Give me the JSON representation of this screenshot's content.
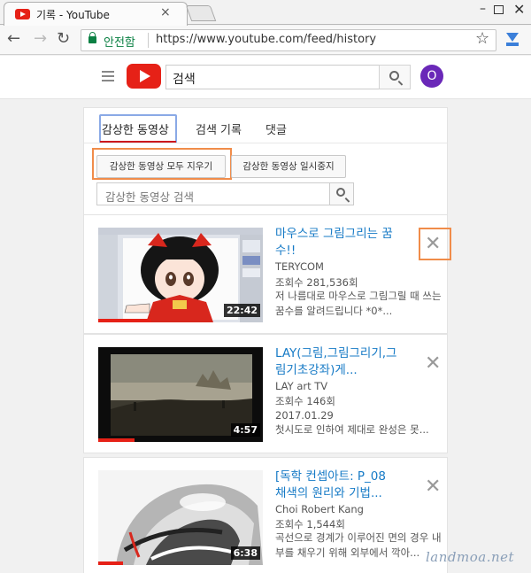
{
  "browser": {
    "tab_title": "기록 - YouTube",
    "tab_close": "×",
    "secure_label": "안전함",
    "url": "https://www.youtube.com/feed/history"
  },
  "youtube": {
    "search_value": "검색",
    "avatar_letter": "O"
  },
  "history_panel": {
    "tabs": [
      {
        "label": "감상한 동영상"
      },
      {
        "label": "검색 기록"
      },
      {
        "label": "댓글"
      }
    ],
    "clear_all_label": "감상한 동영상 모두 지우기",
    "pause_label": "감상한 동영상 일시중지",
    "search_placeholder": "감상한 동영상 검색"
  },
  "videos": [
    {
      "title": "마우스로 그림그리는 꿈수!!",
      "channel": "TERYCOM",
      "views": "조회수 281,536회",
      "date": "",
      "description": "저 나름대로 마우스로 그림그릴 때 쓰는 꿈수를 알려드립니다 *0*...",
      "duration": "22:42",
      "watched_fraction": 0.32
    },
    {
      "title": "LAY(그림,그림그리기,그림기초강좌)게...",
      "channel": "LAY art TV",
      "views": "조회수 146회",
      "date": "2017.01.29",
      "description": "첫시도로 인하여 제대로 완성은 못...",
      "duration": "4:57",
      "watched_fraction": 0.22
    },
    {
      "title": "[독학 컨셉아트: P_08 채색의 원리와 기법...",
      "channel": "Choi Robert Kang",
      "views": "조회수 1,544회",
      "date": "",
      "description": "곡선으로 경계가 이루어진 면의 경우 내부를 채우기 위해 외부에서 깍아...",
      "duration": "6:38",
      "watched_fraction": 0.15
    }
  ],
  "watermark": "landmoa.net"
}
